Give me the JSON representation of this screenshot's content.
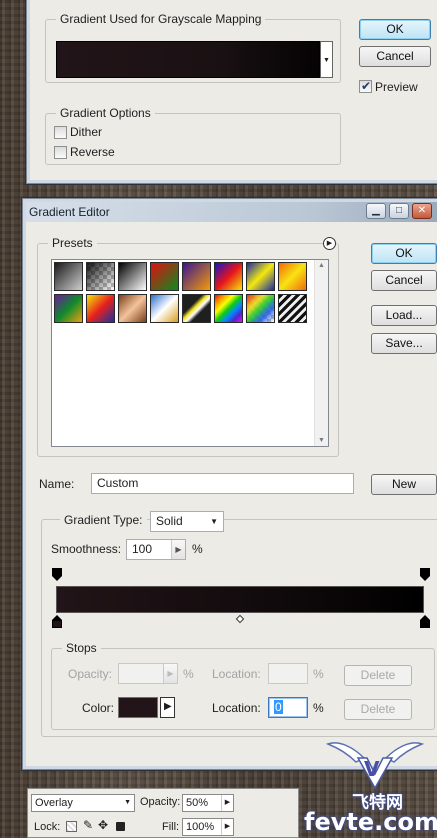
{
  "gradient_map": {
    "group_title": "Gradient Used for Grayscale Mapping",
    "options_title": "Gradient Options",
    "ok_label": "OK",
    "cancel_label": "Cancel",
    "preview_label": "Preview",
    "preview_checked": true,
    "dither_label": "Dither",
    "dither_checked": false,
    "reverse_label": "Reverse",
    "reverse_checked": false,
    "gradient_start_color": "#221418",
    "gradient_end_color": "#000000"
  },
  "gradient_editor": {
    "title": "Gradient Editor",
    "presets_label": "Presets",
    "ok_label": "OK",
    "cancel_label": "Cancel",
    "load_label": "Load...",
    "save_label": "Save...",
    "name_label": "Name:",
    "name_value": "Custom",
    "new_label": "New",
    "gradient_type_label": "Gradient Type:",
    "gradient_type_value": "Solid",
    "smoothness_label": "Smoothness:",
    "smoothness_value": "100",
    "percent": "%",
    "stops_label": "Stops",
    "opacity_label": "Opacity:",
    "location_label": "Location:",
    "delete_label": "Delete",
    "color_label": "Color:",
    "color_location_value": "0",
    "stop_color": "#221418"
  },
  "layers_panel": {
    "blend_mode": "Overlay",
    "opacity_label": "Opacity:",
    "opacity_value": "50%",
    "lock_label": "Lock:",
    "fill_label": "Fill:",
    "fill_value": "100%"
  },
  "watermark": {
    "site_name": "飞特网",
    "domain": "fevte.com"
  }
}
